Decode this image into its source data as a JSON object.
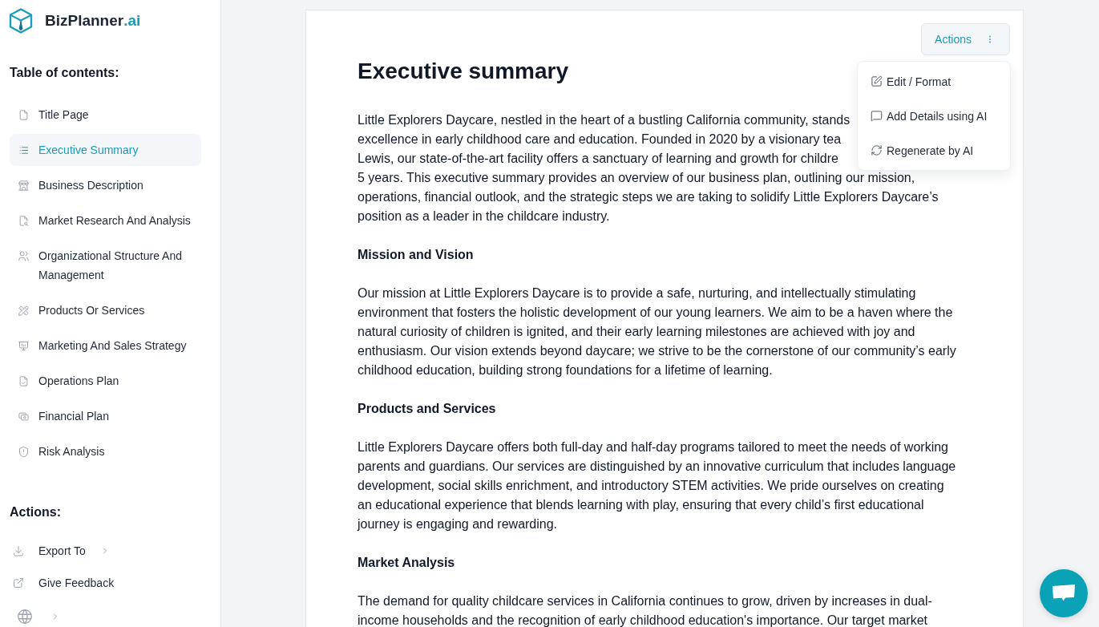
{
  "sidebar": {
    "brand": {
      "name": "BizPlanner",
      "suffix": ".ai"
    },
    "toc_heading": "Table of contents:",
    "toc_items": [
      {
        "label": "Title Page",
        "selected": false
      },
      {
        "label": "Executive Summary",
        "selected": true
      },
      {
        "label": "Business Description",
        "selected": false
      },
      {
        "label": "Market Research And Analysis",
        "selected": false
      },
      {
        "label": "Organizational Structure And Management",
        "selected": false
      },
      {
        "label": "Products Or Services",
        "selected": false
      },
      {
        "label": "Marketing And Sales Strategy",
        "selected": false
      },
      {
        "label": "Operations Plan",
        "selected": false
      },
      {
        "label": "Financial Plan",
        "selected": false
      },
      {
        "label": "Risk Analysis",
        "selected": false
      }
    ],
    "actions_heading": "Actions:",
    "actions": [
      {
        "kind": "submenu",
        "label": "Export To"
      },
      {
        "kind": "link",
        "label": "Give Feedback"
      },
      {
        "kind": "language"
      }
    ]
  },
  "document": {
    "actions_button": {
      "label": "Actions",
      "expanded": true
    },
    "actions_menu": [
      "Edit / Format",
      "Add Details using AI",
      "Regenerate by AI"
    ],
    "title": "Executive summary",
    "blocks": [
      {
        "kind": "covered_lines",
        "lines": [
          "Little Explorers Daycare, nestled in the heart of a bustling California community, stands",
          "excellence in early childhood care and education. Founded in 2020 by a visionary tea",
          "Lewis, our state-of-the-art facility offers a sanctuary of learning and growth for childre",
          "5 years. This executive summary provides an overview of our business plan, outlining our mission,",
          "operations, financial outlook, and the strategic steps we are taking to solidify Little Explorers Daycare’s",
          "position as a leader in the childcare industry."
        ]
      },
      {
        "kind": "heading",
        "text": "Mission and Vision"
      },
      {
        "kind": "paragraph",
        "lines": [
          "Our mission at Little Explorers Daycare is to provide a safe, nurturing, and intellectually stimulating",
          "environment that fosters the holistic development of our young learners. We aim to be a haven where the",
          "natural curiosity of children is ignited, and their early learning milestones are achieved with joy and",
          "enthusiasm. Our vision extends beyond daycare; we strive to be the cornerstone of our community’s early",
          "childhood education, building strong foundations for a lifetime of learning."
        ]
      },
      {
        "kind": "heading",
        "text": "Products and Services"
      },
      {
        "kind": "paragraph",
        "lines": [
          "Little Explorers Daycare offers both full-day and half-day programs tailored to meet the needs of working",
          "parents and guardians. Our services are distinguished by an innovative curriculum that includes language",
          "development, social skills enrichment, and introductory STEM activities. We pride ourselves on creating",
          "an educational experience that blends learning with play, ensuring that every child’s first educational",
          "journey is engaging and rewarding."
        ]
      },
      {
        "kind": "heading",
        "text": "Market Analysis"
      },
      {
        "kind": "paragraph",
        "lines": [
          "The demand for quality childcare services in California continues to grow, driven by increases in dual-",
          "income households and the recognition of early childhood education's importance. Our target market"
        ]
      }
    ]
  }
}
